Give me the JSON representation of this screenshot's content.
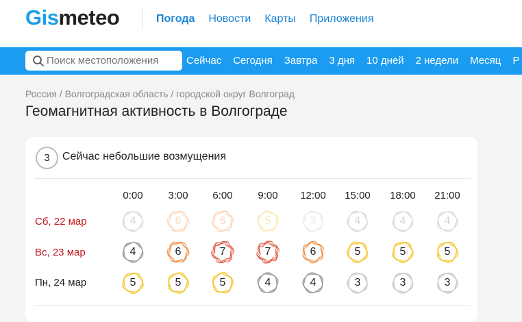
{
  "header": {
    "logo_part1": "Gis",
    "logo_part2": "meteo",
    "nav": [
      {
        "label": "Погода",
        "active": true
      },
      {
        "label": "Новости",
        "active": false
      },
      {
        "label": "Карты",
        "active": false
      },
      {
        "label": "Приложения",
        "active": false
      }
    ]
  },
  "search": {
    "placeholder": "Поиск местоположения",
    "icon": "search-icon"
  },
  "periods": [
    "Сейчас",
    "Сегодня",
    "Завтра",
    "3 дня",
    "10 дней",
    "2 недели",
    "Месяц",
    "Р"
  ],
  "breadcrumb": "Россия / Волгоградская область / городской округ Волгоград",
  "page_title": "Геомагнитная активность в Волгограде",
  "current": {
    "value": "3",
    "text": "Сейчас небольшие возмущения"
  },
  "times": [
    "0:00",
    "3:00",
    "6:00",
    "9:00",
    "12:00",
    "15:00",
    "18:00",
    "21:00"
  ],
  "days": [
    {
      "label": "Сб, 22 мар",
      "color": "red",
      "past": true,
      "values": [
        4,
        6,
        6,
        5,
        3,
        4,
        4,
        4
      ]
    },
    {
      "label": "Вс, 23 мар",
      "color": "red",
      "past": false,
      "values": [
        4,
        6,
        7,
        7,
        6,
        5,
        5,
        5
      ]
    },
    {
      "label": "Пн, 24 мар",
      "color": "dark",
      "past": false,
      "values": [
        5,
        5,
        5,
        4,
        4,
        3,
        3,
        3
      ]
    }
  ],
  "level_colors": {
    "3": "#c4c4c4",
    "4": "#8f8f8f",
    "5": "#f2c21b",
    "6": "#f08a3a",
    "7": "#e2513a"
  },
  "accent": "#1b9cf0"
}
